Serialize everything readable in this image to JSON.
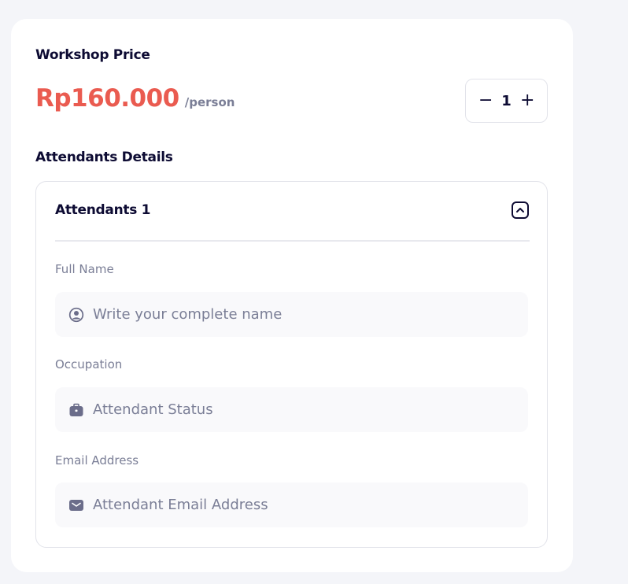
{
  "workshop": {
    "price_title": "Workshop Price",
    "price": "Rp160.000",
    "per_unit": "/person"
  },
  "stepper": {
    "minus": "−",
    "quantity": "1",
    "plus": "+"
  },
  "attendants": {
    "section_title": "Attendants Details",
    "items": [
      {
        "title": "Attendants 1",
        "fields": [
          {
            "label": "Full Name",
            "value": "",
            "placeholder": "Write your complete name",
            "icon": "user-circle-icon"
          },
          {
            "label": "Occupation",
            "value": "",
            "placeholder": "Attendant Status",
            "icon": "briefcase-icon"
          },
          {
            "label": "Email Address",
            "value": "",
            "placeholder": "Attendant Email Address",
            "icon": "mail-icon"
          }
        ]
      }
    ]
  },
  "colors": {
    "accent": "#ea5b50",
    "heading": "#0d0b33",
    "muted": "#7a7e96",
    "icon": "#6b6d8a"
  }
}
